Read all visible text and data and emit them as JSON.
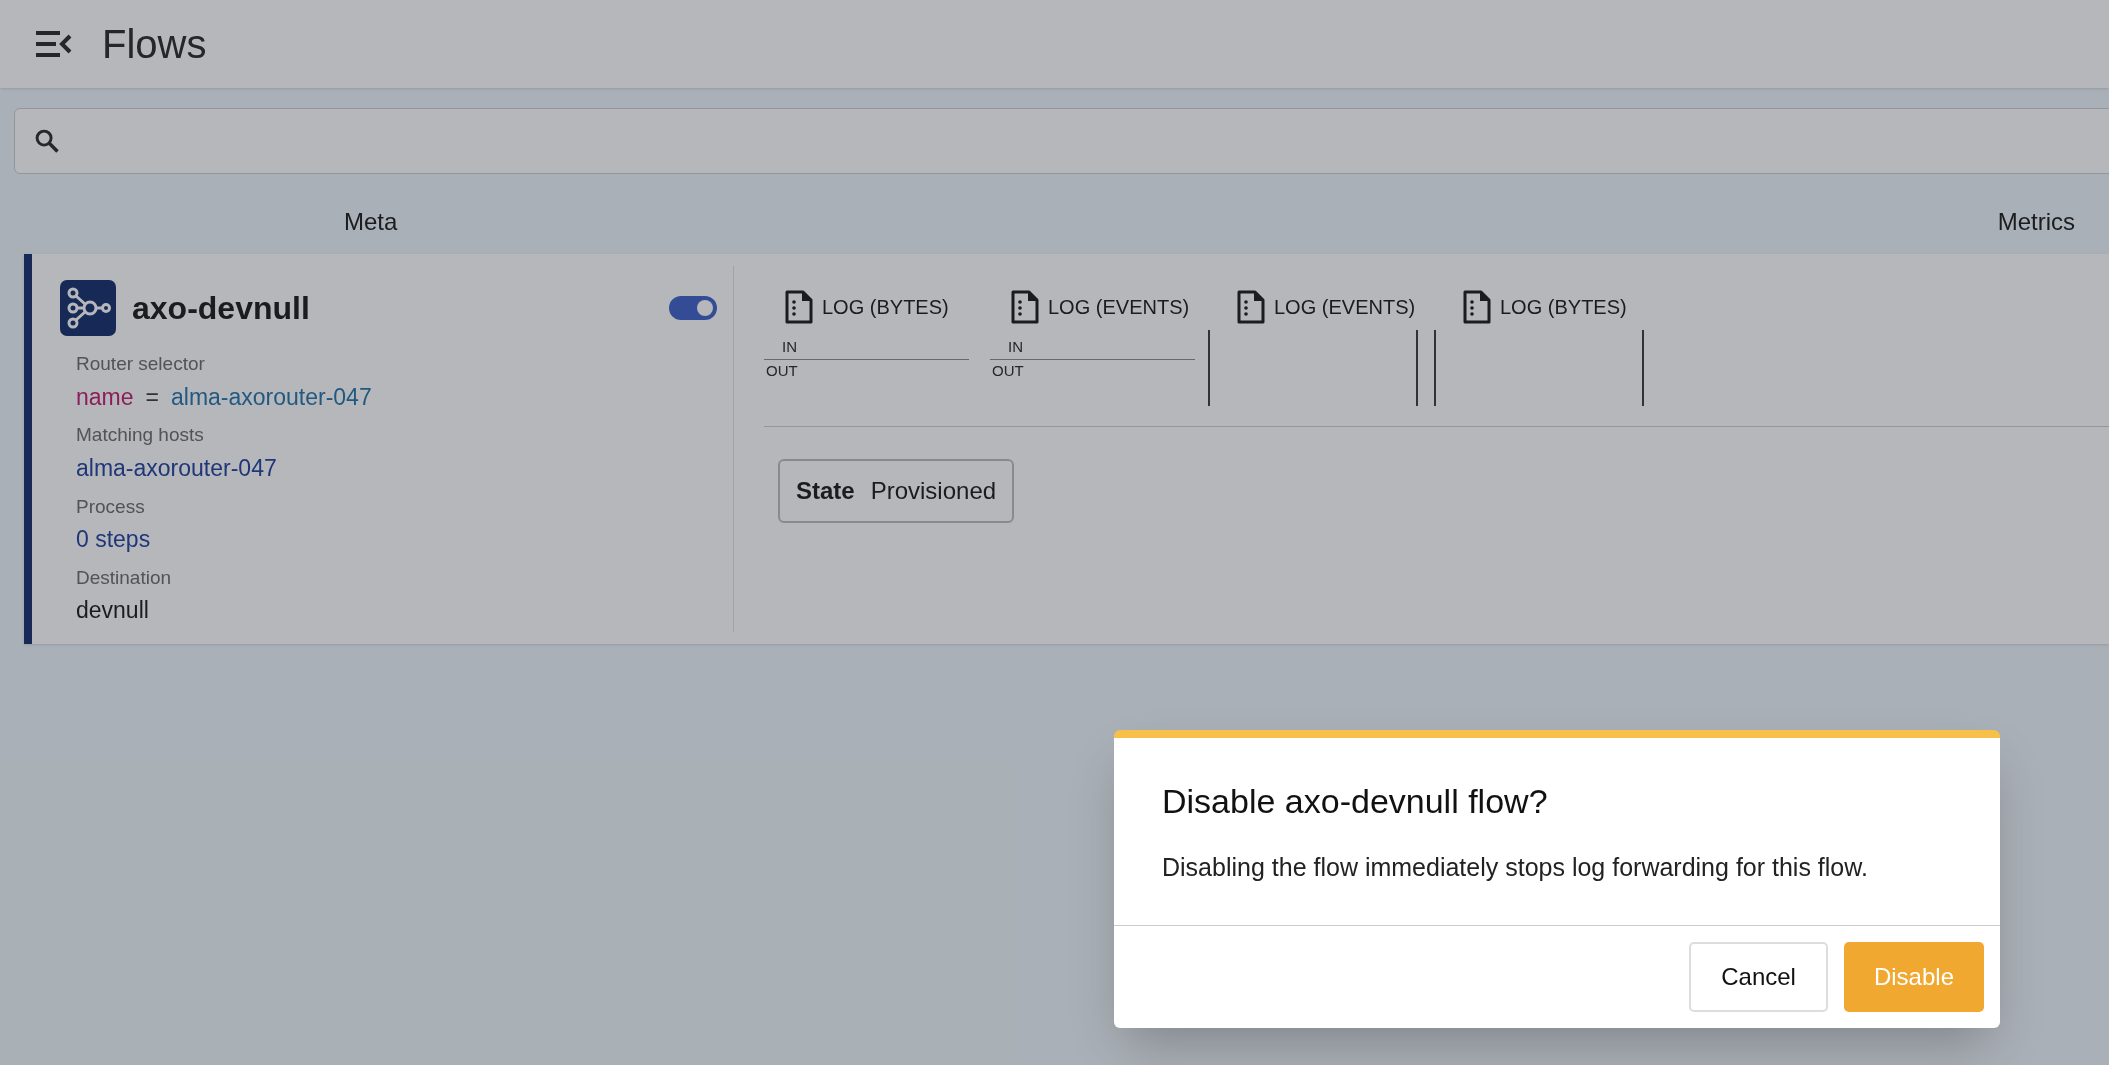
{
  "header": {
    "title": "Flows"
  },
  "columns": [
    "Meta",
    "Metrics"
  ],
  "flow": {
    "name": "axo-devnull",
    "enabled": true,
    "fields": [
      {
        "label": "Router selector",
        "kind": "selector",
        "key": "name",
        "operator": "=",
        "value": "alma-axorouter-047"
      },
      {
        "label": "Matching hosts",
        "kind": "link",
        "value": "alma-axorouter-047"
      },
      {
        "label": "Process",
        "kind": "link",
        "value": "0 steps"
      },
      {
        "label": "Destination",
        "kind": "text",
        "value": "devnull"
      }
    ],
    "metrics": [
      {
        "label": "LOG (BYTES)",
        "kind": "inout",
        "in": "IN",
        "out": "OUT"
      },
      {
        "label": "LOG (EVENTS)",
        "kind": "inout",
        "in": "IN",
        "out": "OUT"
      },
      {
        "label": "LOG (EVENTS)",
        "kind": "empty"
      },
      {
        "label": "LOG (BYTES)",
        "kind": "empty"
      }
    ],
    "state": {
      "label": "State",
      "value": "Provisioned"
    }
  },
  "dialog": {
    "title": "Disable axo-devnull flow?",
    "message": "Disabling the flow immediately stops log forwarding for this flow.",
    "buttons": [
      {
        "label": "Cancel",
        "kind": "secondary"
      },
      {
        "label": "Disable",
        "kind": "primary"
      }
    ]
  }
}
